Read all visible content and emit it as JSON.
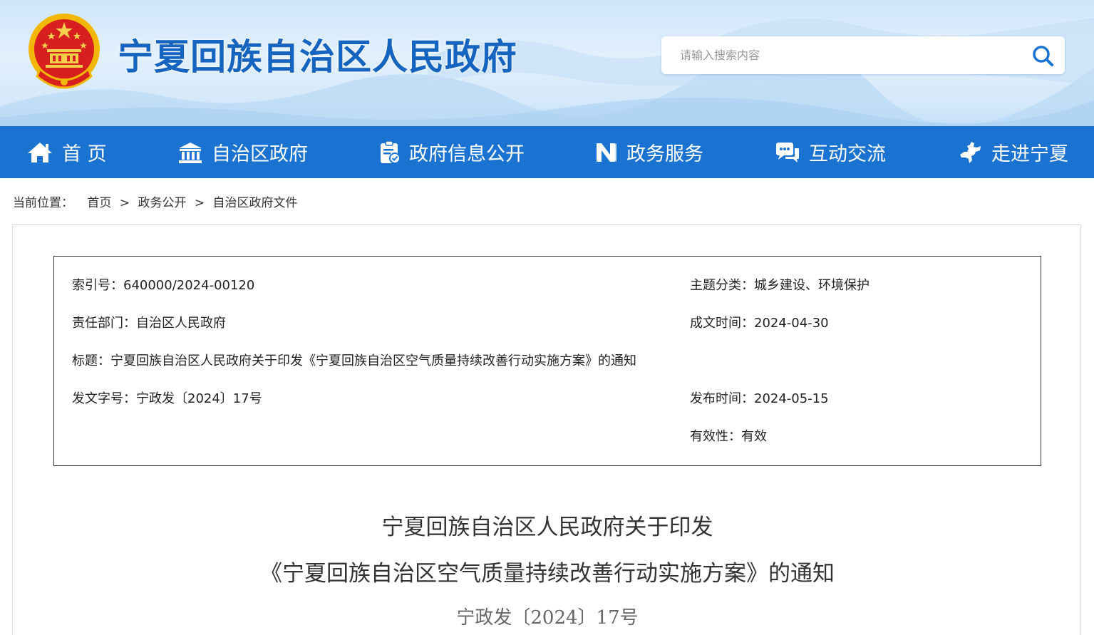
{
  "header": {
    "site_title": "宁夏回族自治区人民政府",
    "search_placeholder": "请输入搜索内容"
  },
  "nav": [
    {
      "label": "首 页",
      "icon": "home-icon"
    },
    {
      "label": "自治区政府",
      "icon": "government-building-icon"
    },
    {
      "label": "政府信息公开",
      "icon": "document-check-icon"
    },
    {
      "label": "政务服务",
      "icon": "service-logo-icon"
    },
    {
      "label": "互动交流",
      "icon": "chat-icon"
    },
    {
      "label": "走进宁夏",
      "icon": "map-region-icon"
    }
  ],
  "breadcrumb": {
    "prefix": "当前位置：",
    "items": [
      "首页",
      "政务公开",
      "自治区政府文件"
    ],
    "separator": ">"
  },
  "info": {
    "index_no": "索引号：640000/2024-00120",
    "topic": "主题分类：城乡建设、环境保护",
    "department": "责任部门：自治区人民政府",
    "created": "成文时间：2024-04-30",
    "title": "标题：宁夏回族自治区人民政府关于印发《宁夏回族自治区空气质量持续改善行动实施方案》的通知",
    "doc_no": "发文字号：宁政发〔2024〕17号",
    "published": "发布时间：2024-05-15",
    "validity": "有效性：有效"
  },
  "document": {
    "title_line1": "宁夏回族自治区人民政府关于印发",
    "title_line2": "《宁夏回族自治区空气质量持续改善行动实施方案》的通知",
    "number": "宁政发〔2024〕17号"
  },
  "colors": {
    "brand_blue": "#1a73d1",
    "title_blue": "#1564c0"
  }
}
